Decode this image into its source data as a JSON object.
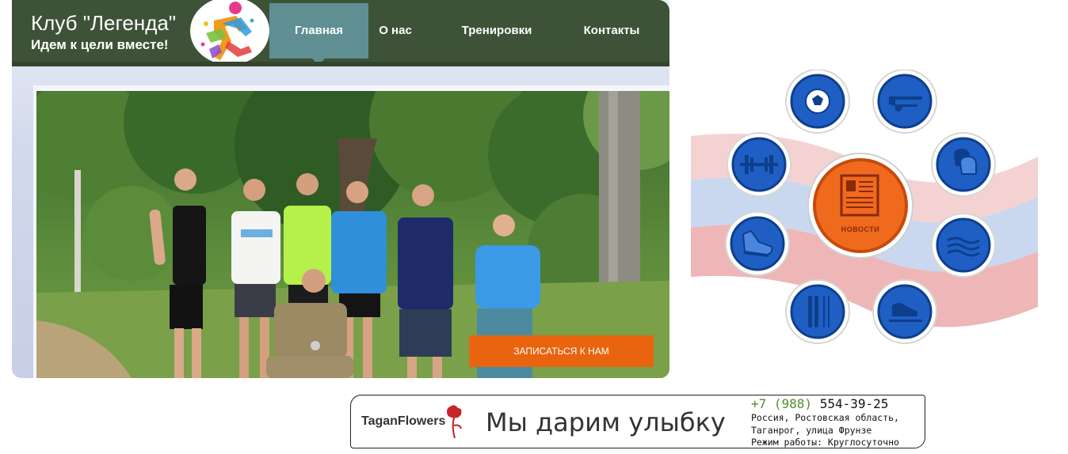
{
  "header": {
    "title": "Клуб \"Легенда\"",
    "subtitle": "Идем к цели вместе!",
    "logo_icon": "runner-logo-icon"
  },
  "nav": {
    "items": [
      {
        "label": "Главная",
        "active": true
      },
      {
        "label": "О нас",
        "active": false
      },
      {
        "label": "Тренировки",
        "active": false
      },
      {
        "label": "Контакты",
        "active": false
      }
    ]
  },
  "hero": {
    "photo": "group-photo-park",
    "cta_label": "ЗАПИСАТЬСЯ К НАМ"
  },
  "sports_panel": {
    "center_label": "НОВОСТИ",
    "icons": [
      "football-icon",
      "rifle-shooting-icon",
      "boxing-glove-icon",
      "swimming-icon",
      "speed-skating-icon",
      "skiing-icon",
      "running-shoe-icon",
      "weightlifting-icon"
    ]
  },
  "ad": {
    "brand": "TaganFlowers",
    "slogan": "Мы дарим улыбку",
    "phone_code": "+7 (988)",
    "phone_number": " 554-39-25",
    "address_line1": "Россия, Ростовская область,",
    "address_line2": "Таганрог, улица Фрунзе",
    "address_line3": "Режим работы: Круглосуточно"
  },
  "colors": {
    "header_bg": "#3e5237",
    "nav_active": "#5f8f93",
    "cta": "#e8640e",
    "sport_blue": "#1f5fc4",
    "news_orange": "#f06a1e",
    "phone_green": "#4e8f2c"
  }
}
